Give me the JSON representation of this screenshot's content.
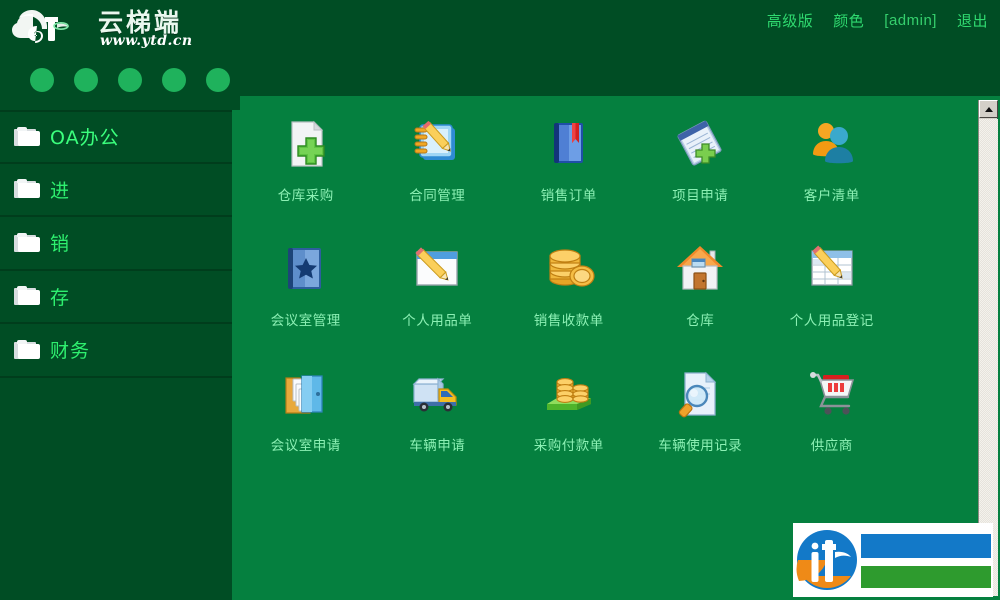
{
  "brand": {
    "logo_icon": "cloud-elephant-logo-icon",
    "name_cn": "云梯端",
    "url": "www.ytd.cn"
  },
  "topnav": {
    "links": [
      {
        "label": "高级版",
        "name": "advanced-version-link"
      },
      {
        "label": "颜色",
        "name": "color-link"
      },
      {
        "label": "[admin]",
        "name": "current-user-link"
      },
      {
        "label": "退出",
        "name": "logout-link"
      }
    ]
  },
  "dots": {
    "count": 5,
    "color": "#1fb25c"
  },
  "sidebar": {
    "accent_color": "#05803f",
    "items": [
      {
        "label": "OA办公",
        "icon": "folder-icon",
        "active": true
      },
      {
        "label": "进",
        "icon": "folder-icon",
        "active": false
      },
      {
        "label": "销",
        "icon": "folder-icon",
        "active": false
      },
      {
        "label": "存",
        "icon": "folder-icon",
        "active": false
      },
      {
        "label": "财务",
        "icon": "folder-icon",
        "active": false
      }
    ]
  },
  "content": {
    "background_color": "#05803f",
    "tiles": [
      {
        "label": "仓库采购",
        "icon": "document-add-icon"
      },
      {
        "label": "合同管理",
        "icon": "notepad-pencil-icon"
      },
      {
        "label": "销售订单",
        "icon": "blue-book-bookmark-icon"
      },
      {
        "label": "项目申请",
        "icon": "notebook-add-icon"
      },
      {
        "label": "客户清单",
        "icon": "two-users-icon"
      },
      {
        "label": "会议室管理",
        "icon": "book-star-icon"
      },
      {
        "label": "个人用品单",
        "icon": "window-pencil-icon"
      },
      {
        "label": "销售收款单",
        "icon": "coin-stack-icon"
      },
      {
        "label": "仓库",
        "icon": "house-icon"
      },
      {
        "label": "个人用品登记",
        "icon": "spreadsheet-pencil-icon"
      },
      {
        "label": "会议室申请",
        "icon": "folder-documents-icon"
      },
      {
        "label": "车辆申请",
        "icon": "truck-icon"
      },
      {
        "label": "采购付款单",
        "icon": "coins-on-grass-icon"
      },
      {
        "label": "车辆使用记录",
        "icon": "document-magnifier-icon"
      },
      {
        "label": "供应商",
        "icon": "shopping-cart-icon"
      }
    ]
  },
  "scrollbar": {
    "up_arrow": "scroll-up-arrow-icon"
  },
  "watermark": {
    "logo_icon": "circular-blue-orange-logo-icon",
    "bar_blue_color": "#1379c8",
    "bar_green_color": "#2e9b2e"
  }
}
